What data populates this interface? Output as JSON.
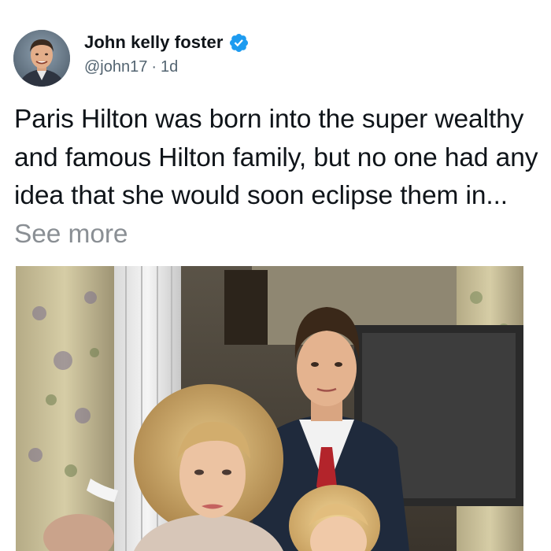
{
  "author": {
    "display_name": "John kelly foster",
    "handle": "@john17",
    "separator": "·",
    "time_ago": "1d",
    "avatar_icon": "avatar-photo",
    "verified_icon": "verified-badge-icon",
    "verified_color": "#1d9bf0"
  },
  "tweet": {
    "body": "Paris Hilton was born into the super wealthy and famous Hilton family, but no one had any idea that she would soon eclipse them in...",
    "see_more_label": "See more",
    "see_more_color": "#8a8f94"
  },
  "media": {
    "type": "photo"
  }
}
